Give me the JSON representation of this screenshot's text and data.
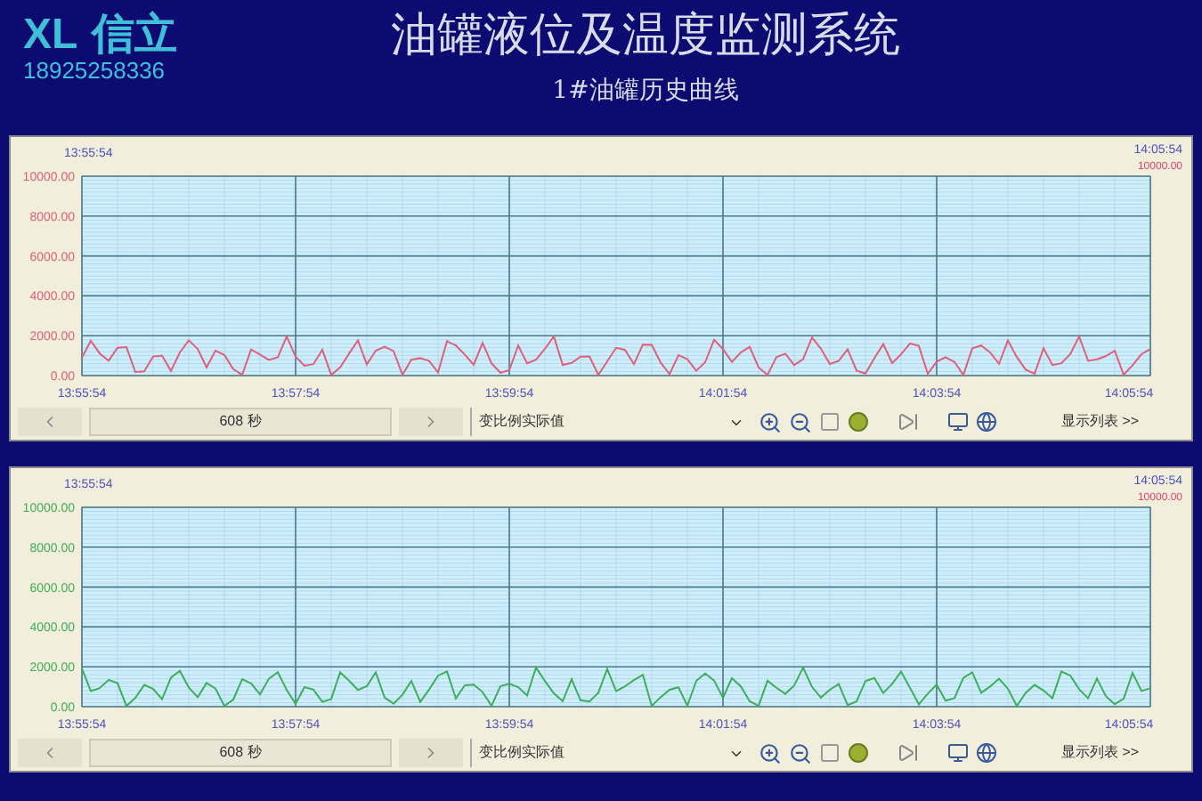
{
  "header": {
    "logo": "XL",
    "logo_cn": "信立",
    "phone": "18925258336",
    "title": "油罐液位及温度监测系统",
    "subtitle": "1#油罐历史曲线"
  },
  "trends": [
    {
      "start_label": "13:55:54",
      "end_label": "14:05:54",
      "cursor_value": "10000.00",
      "color": "#e0607a",
      "y_labels": [
        "10000.00",
        "8000.00",
        "6000.00",
        "4000.00",
        "2000.00",
        "0.00"
      ],
      "x_labels": [
        "13:55:54",
        "13:57:54",
        "13:59:54",
        "14:01:54",
        "14:03:54",
        "14:05:54"
      ],
      "controls": {
        "span": "608 秒",
        "mode": "变比例实际值",
        "list_button": "显示列表 >>"
      }
    },
    {
      "start_label": "13:55:54",
      "end_label": "14:05:54",
      "cursor_value": "10000.00",
      "color": "#3fae5a",
      "y_labels": [
        "10000.00",
        "8000.00",
        "6000.00",
        "4000.00",
        "2000.00",
        "0.00"
      ],
      "x_labels": [
        "13:55:54",
        "13:57:54",
        "13:59:54",
        "14:01:54",
        "14:03:54",
        "14:05:54"
      ],
      "controls": {
        "span": "608 秒",
        "mode": "变比例实际值",
        "list_button": "显示列表 >>"
      }
    }
  ]
}
